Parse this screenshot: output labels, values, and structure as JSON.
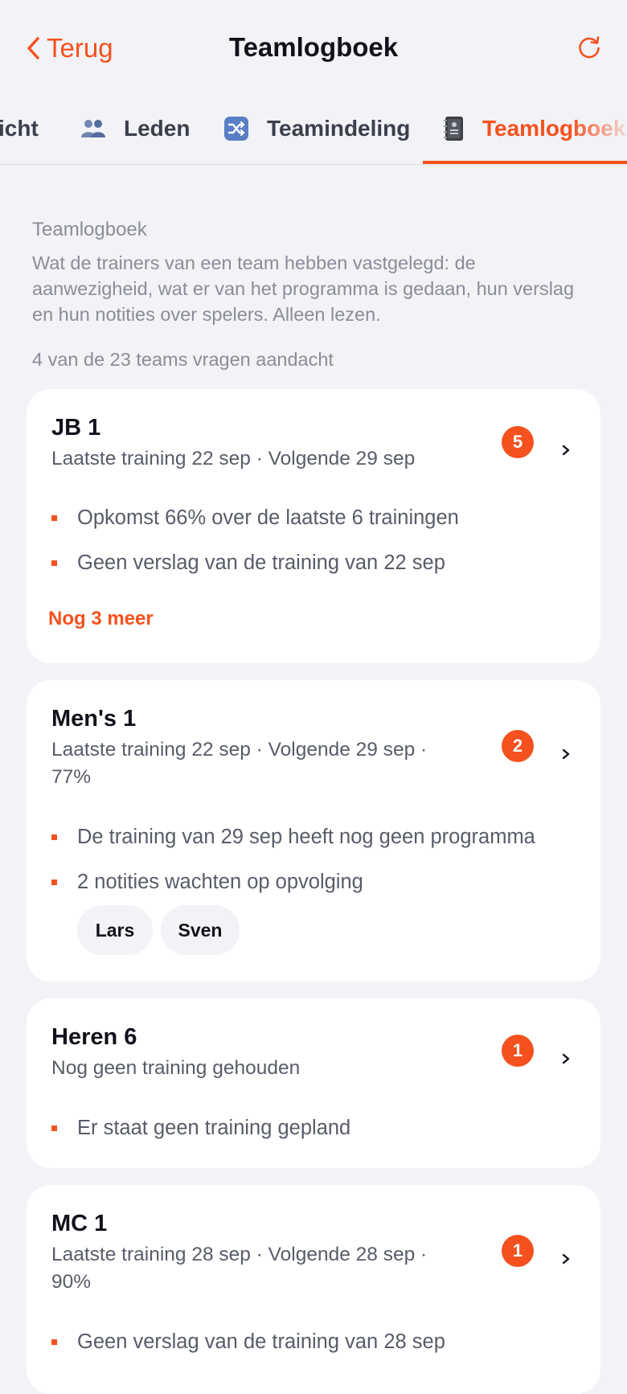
{
  "header": {
    "back_label": "Terug",
    "title": "Teamlogboek",
    "back_icon": "chevron-left-icon",
    "refresh_icon": "refresh-icon"
  },
  "tabs": [
    {
      "label": "icht",
      "icon": "overview-icon",
      "active": false
    },
    {
      "label": "Leden",
      "icon": "people-icon",
      "active": false
    },
    {
      "label": "Teamindeling",
      "icon": "shuffle-icon",
      "active": false
    },
    {
      "label": "Teamlogboek",
      "icon": "notebook-icon",
      "active": true
    }
  ],
  "intro": {
    "title": "Teamlogboek",
    "description": "Wat de trainers van een team hebben vastgelegd: de aanwezigheid, wat er van het programma is gedaan, hun verslag en hun notities over spelers. Alleen lezen.",
    "summary": "4 van de 23 teams vragen aandacht"
  },
  "teams": [
    {
      "name": "JB 1",
      "meta": "Laatste training 22 sep · Volgende 29 sep",
      "badge": "5",
      "issues": [
        "Opkomst 66% over de laatste 6 trainingen",
        "Geen verslag van de training van 22 sep"
      ],
      "more": "Nog 3 meer"
    },
    {
      "name": "Men's 1",
      "meta": "Laatste training 22 sep · Volgende 29 sep · 77%",
      "badge": "2",
      "issues": [
        "De training van 29 sep heeft nog geen programma",
        "2 notities wachten op opvolging"
      ],
      "players": [
        "Lars",
        "Sven"
      ]
    },
    {
      "name": "Heren 6",
      "meta": "Nog geen training gehouden",
      "badge": "1",
      "issues": [
        "Er staat geen training gepland"
      ]
    },
    {
      "name": "MC 1",
      "meta": "Laatste training 28 sep · Volgende 28 sep · 90%",
      "badge": "1",
      "issues": [
        "Geen verslag van de training van 28 sep"
      ]
    }
  ],
  "colors": {
    "accent": "#f4511e",
    "background": "#f2f2f7",
    "card": "#ffffff",
    "muted_text": "#8a8d99"
  }
}
